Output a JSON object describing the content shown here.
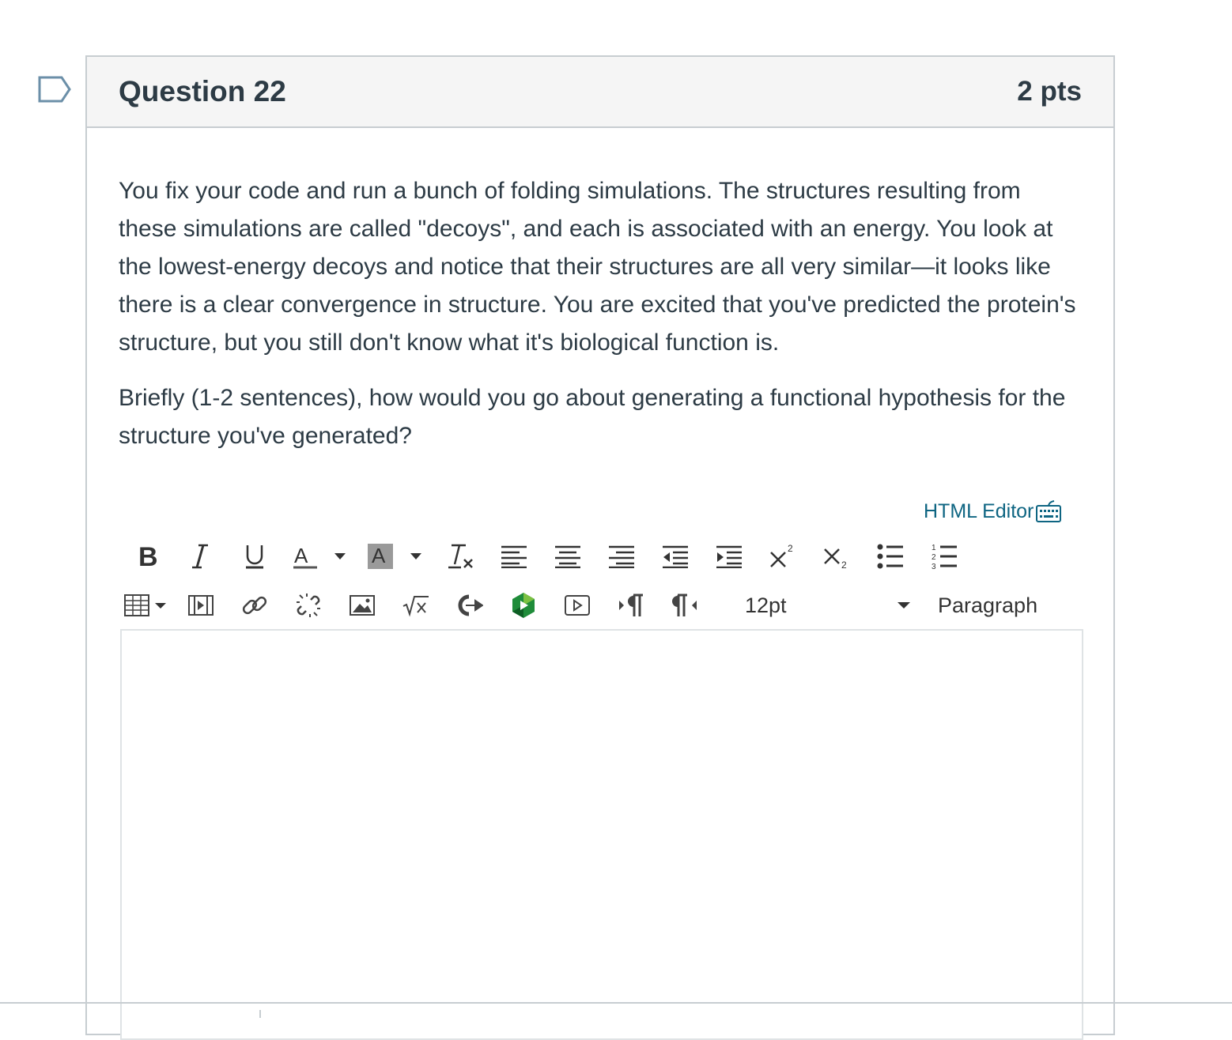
{
  "question": {
    "title": "Question 22",
    "points": "2 pts",
    "paragraphs": [
      "You fix your code and run a bunch of folding simulations. The structures resulting from these simulations are called \"decoys\", and each is associated with an energy. You look at the lowest-energy decoys and notice that their structures are all very similar—it looks like there is a clear convergence in structure. You are excited that you've predicted the protein's structure, but you still don't know what it's biological function is.",
      "Briefly (1-2 sentences), how would you go about generating a functional hypothesis for the structure you've generated?"
    ]
  },
  "editor": {
    "html_editor_label": "HTML Editor",
    "font_size": "12pt",
    "block_format": "Paragraph",
    "toolbar_row1": [
      "bold-icon",
      "italic-icon",
      "underline-icon",
      "text-color-icon",
      "background-color-icon",
      "clear-formatting-icon",
      "align-left-icon",
      "align-center-icon",
      "align-right-icon",
      "outdent-icon",
      "indent-icon",
      "superscript-icon",
      "subscript-icon",
      "bullet-list-icon",
      "numbered-list-icon"
    ],
    "toolbar_row2": [
      "table-icon",
      "media-icon",
      "link-icon",
      "unlink-icon",
      "image-icon",
      "math-icon",
      "lti-tool-icon",
      "app-icon",
      "video-icon",
      "ltr-icon",
      "rtl-icon"
    ],
    "content": ""
  },
  "colors": {
    "link": "#0e6582",
    "text": "#2d3b45",
    "header_bg": "#f5f5f5",
    "border": "#c7cdd1"
  }
}
